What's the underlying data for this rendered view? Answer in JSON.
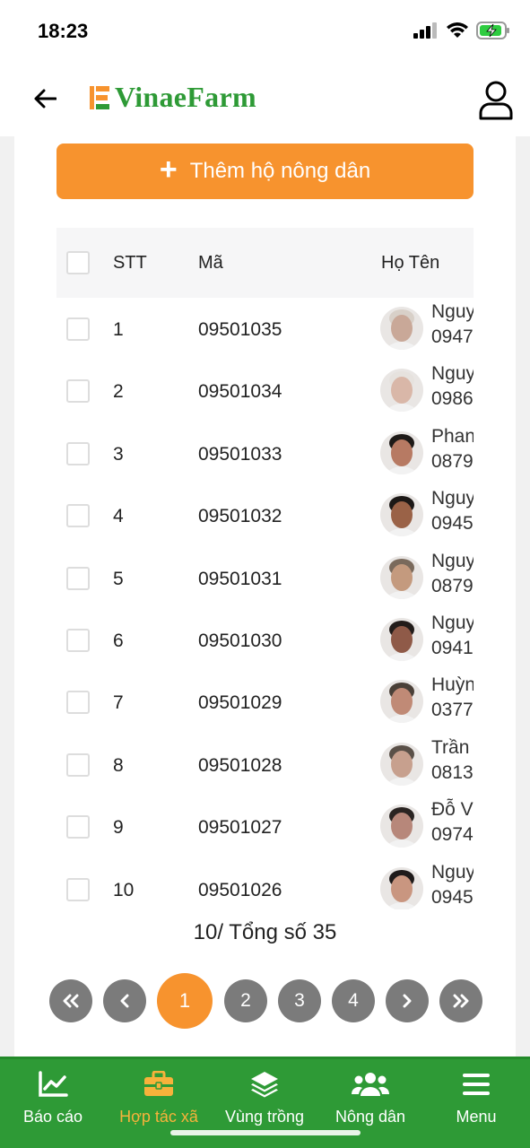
{
  "status": {
    "time": "18:23"
  },
  "header": {
    "brand": "VinaeFarm"
  },
  "actions": {
    "add_label": "Thêm hộ nông dân"
  },
  "table": {
    "columns": {
      "stt": "STT",
      "code": "Mã",
      "name": "Họ Tên"
    },
    "rows": [
      {
        "stt": "1",
        "code": "09501035",
        "name": "Nguy",
        "phone": "0947",
        "skin": "#c9a898",
        "hair": "#d8d0c8"
      },
      {
        "stt": "2",
        "code": "09501034",
        "name": "Nguy",
        "phone": "0986",
        "skin": "#d9b7a8",
        "hair": "#e6e2de"
      },
      {
        "stt": "3",
        "code": "09501033",
        "name": "Phan",
        "phone": "0879",
        "skin": "#b77a63",
        "hair": "#1e1a18"
      },
      {
        "stt": "4",
        "code": "09501032",
        "name": "Nguy",
        "phone": "0945",
        "skin": "#9a6247",
        "hair": "#1c1816"
      },
      {
        "stt": "5",
        "code": "09501031",
        "name": "Nguy",
        "phone": "0879",
        "skin": "#c49a7e",
        "hair": "#7a6a5c"
      },
      {
        "stt": "6",
        "code": "09501030",
        "name": "Nguy",
        "phone": "0941",
        "skin": "#8f5a48",
        "hair": "#221c1a"
      },
      {
        "stt": "7",
        "code": "09501029",
        "name": "Huỳn",
        "phone": "0377",
        "skin": "#c08a76",
        "hair": "#4a4038"
      },
      {
        "stt": "8",
        "code": "09501028",
        "name": "Trần",
        "phone": "0813",
        "skin": "#c7a08e",
        "hair": "#5a5048"
      },
      {
        "stt": "9",
        "code": "09501027",
        "name": "Đỗ V",
        "phone": "0974",
        "skin": "#b7877a",
        "hair": "#2a2422"
      },
      {
        "stt": "10",
        "code": "09501026",
        "name": "Nguy",
        "phone": "0945",
        "skin": "#c99680",
        "hair": "#1e1a1a"
      }
    ]
  },
  "summary": {
    "total_text": "10/ Tổng số 35"
  },
  "pagination": {
    "first_icon": "double-chevron-left-icon",
    "prev_icon": "chevron-left-icon",
    "pages": [
      "1",
      "2",
      "3",
      "4"
    ],
    "current": "1",
    "next_icon": "chevron-right-icon",
    "last_icon": "double-chevron-right-icon"
  },
  "bottom_nav": {
    "items": [
      {
        "label": "Báo cáo",
        "icon": "chart-icon"
      },
      {
        "label": "Hợp tác xã",
        "icon": "briefcase-icon",
        "active": true
      },
      {
        "label": "Vùng trồng",
        "icon": "layers-icon"
      },
      {
        "label": "Nông dân",
        "icon": "users-icon"
      },
      {
        "label": "Menu",
        "icon": "menu-icon"
      }
    ]
  },
  "colors": {
    "primary_green": "#2e9a36",
    "accent_orange": "#f7932e",
    "active_nav": "#f7b23b",
    "pager_gray": "#7b7b7b"
  }
}
